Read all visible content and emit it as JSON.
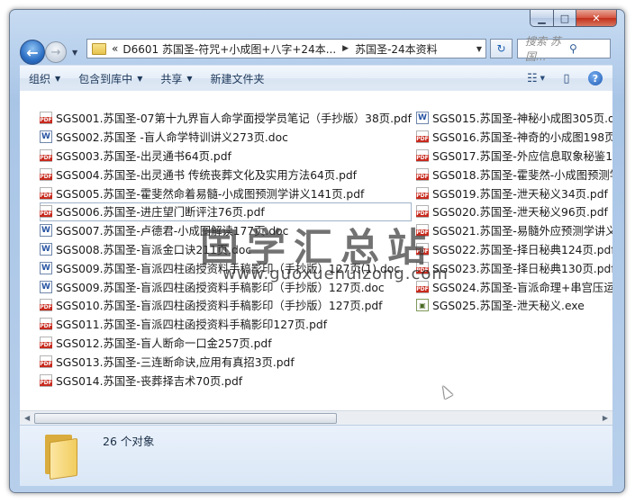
{
  "address": {
    "chevron": "«",
    "crumbs": [
      "D6601 苏国圣-符咒+小成图+八字+24本...",
      "苏国圣-24本资料"
    ],
    "search_placeholder": "搜索 苏国..."
  },
  "toolbar": {
    "organize": "组织",
    "include_in_library": "包含到库中",
    "share": "共享",
    "new_folder": "新建文件夹"
  },
  "files_left": [
    {
      "name": "SGS001.苏国圣-07第十九界盲人命学面授学员笔记（手抄版）38页.pdf",
      "type": "pdf"
    },
    {
      "name": "SGS002.苏国圣 -盲人命学特训讲义273页.doc",
      "type": "doc"
    },
    {
      "name": "SGS003.苏国圣-出灵通书64页.pdf",
      "type": "pdf"
    },
    {
      "name": "SGS004.苏国圣-出灵通书 传统丧葬文化及实用方法64页.pdf",
      "type": "pdf"
    },
    {
      "name": "SGS005.苏国圣-霍斐然命着易髓-小成图预测学讲义141页.pdf",
      "type": "pdf"
    },
    {
      "name": "SGS006.苏国圣-进庄望门断评注76页.pdf",
      "type": "pdf"
    },
    {
      "name": "SGS007.苏国圣-卢德君-小成图解读177页.doc",
      "type": "doc"
    },
    {
      "name": "SGS008.苏国圣-盲派金口诀211页.doc",
      "type": "doc"
    },
    {
      "name": "SGS009.苏国圣-盲派四柱函授资料手稿影印（手抄版）127页(1).doc",
      "type": "doc"
    },
    {
      "name": "SGS009.苏国圣-盲派四柱函授资料手稿影印（手抄版）127页.doc",
      "type": "doc"
    },
    {
      "name": "SGS010.苏国圣-盲派四柱函授资料手稿影印（手抄版）127页.pdf",
      "type": "pdf"
    },
    {
      "name": "SGS011.苏国圣-盲派四柱函授资料手稿影印127页.pdf",
      "type": "pdf"
    },
    {
      "name": "SGS012.苏国圣-盲人断命一口金257页.pdf",
      "type": "pdf"
    },
    {
      "name": "SGS013.苏国圣-三连断命诀,应用有真招3页.pdf",
      "type": "pdf"
    },
    {
      "name": "SGS014.苏国圣-丧葬择吉术70页.pdf",
      "type": "pdf"
    }
  ],
  "files_right": [
    {
      "name": "SGS015.苏国圣-神秘小成图305页.doc",
      "type": "doc"
    },
    {
      "name": "SGS016.苏国圣-神奇的小成图198页.pdf",
      "type": "pdf"
    },
    {
      "name": "SGS017.苏国圣-外应信息取象秘鉴104页.pdf",
      "type": "pdf"
    },
    {
      "name": "SGS018.苏国圣-霍斐然-小成图预测学讲义.pdf",
      "type": "pdf"
    },
    {
      "name": "SGS019.苏国圣-泄天秘义34页.pdf",
      "type": "pdf"
    },
    {
      "name": "SGS020.苏国圣-泄天秘义96页.pdf",
      "type": "pdf"
    },
    {
      "name": "SGS021.苏国圣-易髓外应预测学讲义.pdf",
      "type": "pdf"
    },
    {
      "name": "SGS022.苏国圣-择日秘典124页.pdf",
      "type": "pdf"
    },
    {
      "name": "SGS023.苏国圣-择日秘典130页.pdf",
      "type": "pdf"
    },
    {
      "name": "SGS024.苏国圣-盲派命理+串宫压运.pdf",
      "type": "pdf"
    },
    {
      "name": "SGS025.苏国圣-泄天秘义.exe",
      "type": "exe"
    }
  ],
  "status": {
    "count": "26 个对象"
  },
  "watermark": {
    "text": "国学汇总站",
    "url": "www.guoxuehuizong.com"
  }
}
